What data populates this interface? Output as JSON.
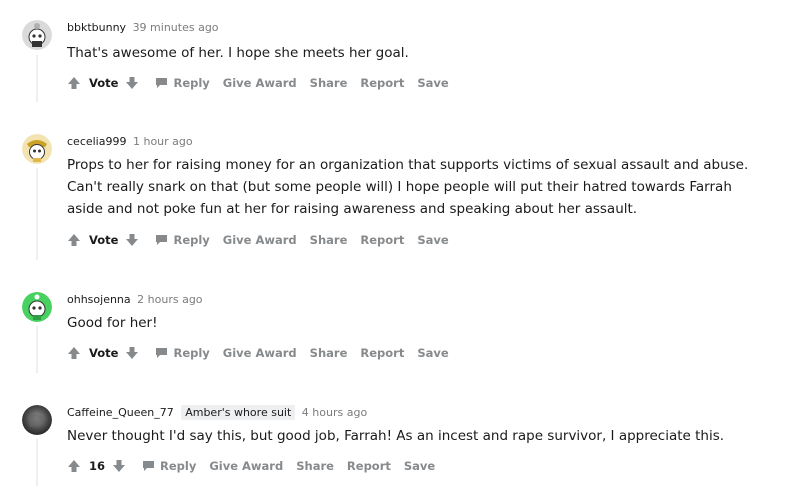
{
  "comments": [
    {
      "username": "bbktbunny",
      "time": "39 minutes ago",
      "flair": "",
      "text": "That's awesome of her. I hope she meets her goal.",
      "vote": "Vote",
      "avatar_icon": "snoo-avatar-icon"
    },
    {
      "username": "cecelia999",
      "time": "1 hour ago",
      "flair": "",
      "text": "Props to her for raising money for an organization that supports victims of sexual assault and abuse. Can't really snark on that (but some people will) I hope people will put their hatred towards Farrah aside and not poke fun at her for raising awareness and speaking about her assault.",
      "vote": "Vote",
      "avatar_icon": "snoo-avatar-icon"
    },
    {
      "username": "ohhsojenna",
      "time": "2 hours ago",
      "flair": "",
      "text": "Good for her!",
      "vote": "Vote",
      "avatar_icon": "snoo-avatar-icon"
    },
    {
      "username": "Caffeine_Queen_77",
      "time": "4 hours ago",
      "flair": "Amber's whore suit",
      "text": "Never thought I'd say this, but good job, Farrah! As an incest and rape survivor, I appreciate this.",
      "vote": "16",
      "avatar_icon": "user-photo-avatar-icon"
    }
  ],
  "actions": {
    "reply": "Reply",
    "give_award": "Give Award",
    "share": "Share",
    "report": "Report",
    "save": "Save"
  },
  "colors": {
    "text": "#1a1a1b",
    "meta": "#7c7c7c",
    "action": "#878a8c",
    "thread_line": "#edeff1",
    "avatar_green": "#46d160",
    "avatar_yellow": "#ffd635"
  }
}
